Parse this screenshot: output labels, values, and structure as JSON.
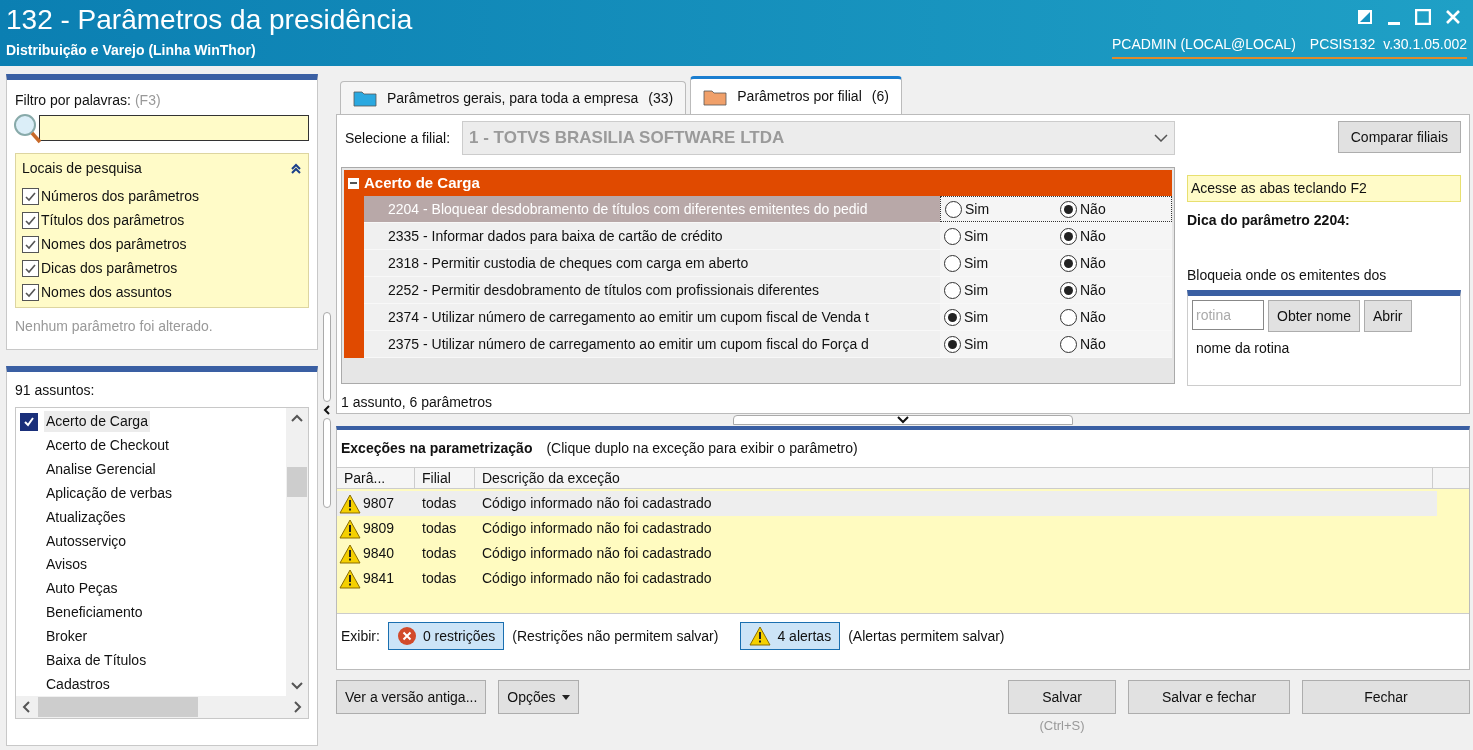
{
  "window": {
    "title": "132 - Parâmetros da presidência",
    "subtitle": "Distribuição e Varejo (Linha WinThor)",
    "user": "PCADMIN (LOCAL@LOCAL)",
    "routine": "PCSIS132",
    "version": "v.30.1.05.002"
  },
  "filter": {
    "label": "Filtro por palavras:",
    "shortcut": "(F3)",
    "search_places": {
      "title": "Locais de pesquisa",
      "expanded": true,
      "options": [
        {
          "label": "Números dos parâmetros",
          "checked": true
        },
        {
          "label": "Títulos dos parâmetros",
          "checked": true
        },
        {
          "label": "Nomes dos parâmetros",
          "checked": true
        },
        {
          "label": "Dicas dos parâmetros",
          "checked": true
        },
        {
          "label": "Nomes dos assuntos",
          "checked": true
        }
      ]
    },
    "status": "Nenhum parâmetro foi alterado."
  },
  "subjects": {
    "title": "91 assuntos:",
    "items": [
      {
        "label": "Acerto de Carga",
        "selected": true
      },
      {
        "label": "Acerto de Checkout",
        "selected": false
      },
      {
        "label": "Analise Gerencial",
        "selected": false
      },
      {
        "label": "Aplicação de verbas",
        "selected": false
      },
      {
        "label": "Atualizações",
        "selected": false
      },
      {
        "label": "Autosserviço",
        "selected": false
      },
      {
        "label": "Avisos",
        "selected": false
      },
      {
        "label": "Auto Peças",
        "selected": false
      },
      {
        "label": "Beneficiamento",
        "selected": false
      },
      {
        "label": "Broker",
        "selected": false
      },
      {
        "label": "Baixa de Títulos",
        "selected": false
      },
      {
        "label": "Cadastros",
        "selected": false
      }
    ]
  },
  "tabs": [
    {
      "label": "Parâmetros gerais, para toda a empresa",
      "count": "(33)",
      "selected": false
    },
    {
      "label": "Parâmetros por filial",
      "count": "(6)",
      "selected": true
    }
  ],
  "branch": {
    "label": "Selecione a filial:",
    "value": "1 - TOTVS BRASILIA SOFTWARE LTDA",
    "disabled": true,
    "compare_button": "Comparar filiais"
  },
  "group": {
    "title": "Acerto de Carga",
    "expanded": true,
    "parameters": [
      {
        "text": "2204 - Bloquear desdobramento de títulos com diferentes emitentes do pedid",
        "selected": true,
        "options": [
          {
            "label": "Sim",
            "selected": false
          },
          {
            "label": "Não",
            "selected": true
          }
        ]
      },
      {
        "text": "2335 - Informar dados para baixa de cartão de crédito",
        "selected": false,
        "options": [
          {
            "label": "Sim",
            "selected": false
          },
          {
            "label": "Não",
            "selected": true
          }
        ]
      },
      {
        "text": "2318 - Permitir custodia de cheques com carga em aberto",
        "selected": false,
        "options": [
          {
            "label": "Sim",
            "selected": false
          },
          {
            "label": "Não",
            "selected": true
          }
        ]
      },
      {
        "text": "2252 - Permitir desdobramento de títulos com profissionais diferentes",
        "selected": false,
        "options": [
          {
            "label": "Sim",
            "selected": false
          },
          {
            "label": "Não",
            "selected": true
          }
        ]
      },
      {
        "text": "2374 - Utilizar número de carregamento ao emitir um cupom fiscal de Venda t",
        "selected": false,
        "options": [
          {
            "label": "Sim",
            "selected": true
          },
          {
            "label": "Não",
            "selected": false
          }
        ]
      },
      {
        "text": "2375 - Utilizar número de carregamento ao emitir um cupom fiscal do Força d",
        "selected": false,
        "options": [
          {
            "label": "Sim",
            "selected": true
          },
          {
            "label": "Não",
            "selected": false
          }
        ]
      }
    ]
  },
  "summary": "1 assunto, 6 parâmetros",
  "hint": {
    "notice": "Acesse as abas teclando F2",
    "title": "Dica do parâmetro 2204:",
    "text": "Bloqueia onde os emitentes dos"
  },
  "routine_lookup": {
    "placeholder": "rotina",
    "buttons": [
      "Obter nome",
      "Abrir"
    ],
    "name": "nome da rotina"
  },
  "exceptions": {
    "title": "Exceções na parametrização",
    "subtitle": "(Clique duplo na exceção para exibir o parâmetro)",
    "columns": [
      "Parâ...",
      "Filial",
      "Descrição da exceção"
    ],
    "rows": [
      {
        "kind": "alert",
        "parameter": "9807",
        "branch": "todas",
        "description": "Código informado não foi cadastrado",
        "selected": true
      },
      {
        "kind": "alert",
        "parameter": "9809",
        "branch": "todas",
        "description": "Código informado não foi cadastrado",
        "selected": false
      },
      {
        "kind": "alert",
        "parameter": "9840",
        "branch": "todas",
        "description": "Código informado não foi cadastrado",
        "selected": false
      },
      {
        "kind": "alert",
        "parameter": "9841",
        "branch": "todas",
        "description": "Código informado não foi cadastrado",
        "selected": false
      }
    ],
    "show_label": "Exibir:",
    "toggles": [
      {
        "kind": "restriction",
        "label": "0 restrições",
        "note": "(Restrições não permitem salvar)",
        "on": true
      },
      {
        "kind": "alert",
        "label": "4 alertas",
        "note": "(Alertas permitem salvar)",
        "on": true
      }
    ]
  },
  "footer": {
    "left_buttons": [
      {
        "label": "Ver a versão antiga...",
        "kind": "plain"
      },
      {
        "label": "Opções",
        "kind": "menu"
      }
    ],
    "right_buttons": [
      {
        "label": "Salvar",
        "shortcut": "(Ctrl+S)"
      },
      {
        "label": "Salvar e fechar"
      },
      {
        "label": "Fechar"
      }
    ]
  }
}
